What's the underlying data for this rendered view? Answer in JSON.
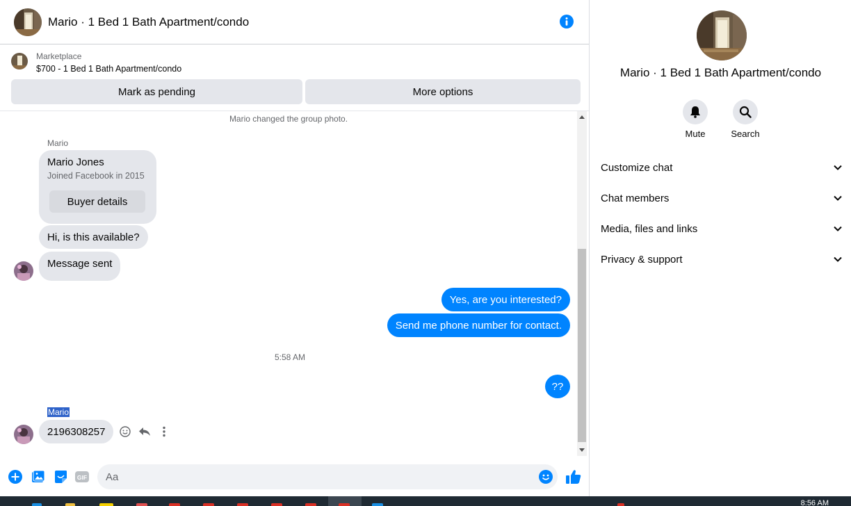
{
  "header": {
    "title": "Mario · 1 Bed 1 Bath Apartment/condo"
  },
  "marketplace": {
    "label": "Marketplace",
    "item": "$700 - 1 Bed 1 Bath Apartment/condo",
    "pending_button": "Mark as pending",
    "options_button": "More options"
  },
  "messages": {
    "system_notice": "Mario changed the group photo.",
    "sender_top": "Mario",
    "card": {
      "name": "Mario Jones",
      "joined": "Joined Facebook in 2015",
      "button": "Buyer details"
    },
    "incoming_1": "Hi, is this available?",
    "incoming_2": "Message sent",
    "outgoing_1": "Yes, are you interested?",
    "outgoing_2": "Send me phone number for contact.",
    "timestamp": "5:58 AM",
    "outgoing_3": "??",
    "sender_bottom": "Mario",
    "incoming_3": "2196308257"
  },
  "composer": {
    "placeholder": "Aa",
    "gif_label": "GIF"
  },
  "panel": {
    "title": "Mario · 1 Bed 1 Bath Apartment/condo",
    "mute_label": "Mute",
    "search_label": "Search",
    "menu": [
      {
        "label": "Customize chat"
      },
      {
        "label": "Chat members"
      },
      {
        "label": "Media, files and links"
      },
      {
        "label": "Privacy & support"
      }
    ]
  },
  "taskbar": {
    "time": "8:56 AM"
  },
  "colors": {
    "accent": "#0084ff",
    "bubble_gray": "#e4e6eb",
    "secondary_text": "#65676b"
  }
}
